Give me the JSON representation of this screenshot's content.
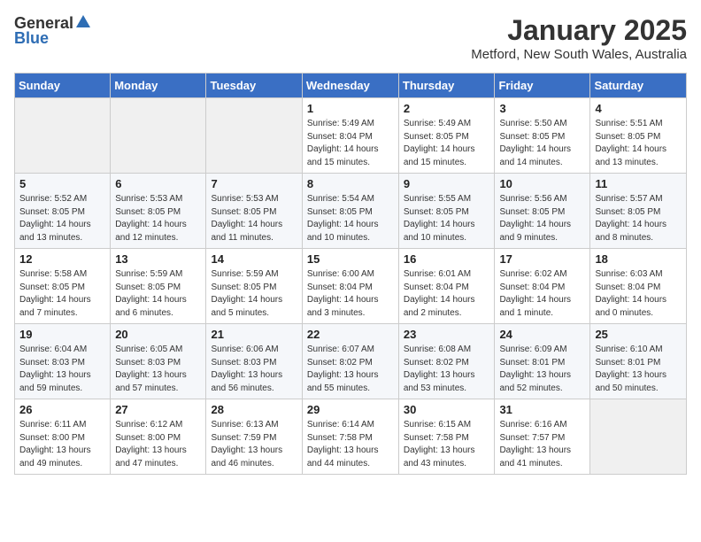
{
  "logo": {
    "general": "General",
    "blue": "Blue"
  },
  "header": {
    "month_year": "January 2025",
    "location": "Metford, New South Wales, Australia"
  },
  "weekdays": [
    "Sunday",
    "Monday",
    "Tuesday",
    "Wednesday",
    "Thursday",
    "Friday",
    "Saturday"
  ],
  "weeks": [
    [
      {
        "day": "",
        "sunrise": "",
        "sunset": "",
        "daylight": "",
        "empty": true
      },
      {
        "day": "",
        "sunrise": "",
        "sunset": "",
        "daylight": "",
        "empty": true
      },
      {
        "day": "",
        "sunrise": "",
        "sunset": "",
        "daylight": "",
        "empty": true
      },
      {
        "day": "1",
        "sunrise": "Sunrise: 5:49 AM",
        "sunset": "Sunset: 8:04 PM",
        "daylight": "Daylight: 14 hours and 15 minutes."
      },
      {
        "day": "2",
        "sunrise": "Sunrise: 5:49 AM",
        "sunset": "Sunset: 8:05 PM",
        "daylight": "Daylight: 14 hours and 15 minutes."
      },
      {
        "day": "3",
        "sunrise": "Sunrise: 5:50 AM",
        "sunset": "Sunset: 8:05 PM",
        "daylight": "Daylight: 14 hours and 14 minutes."
      },
      {
        "day": "4",
        "sunrise": "Sunrise: 5:51 AM",
        "sunset": "Sunset: 8:05 PM",
        "daylight": "Daylight: 14 hours and 13 minutes."
      }
    ],
    [
      {
        "day": "5",
        "sunrise": "Sunrise: 5:52 AM",
        "sunset": "Sunset: 8:05 PM",
        "daylight": "Daylight: 14 hours and 13 minutes."
      },
      {
        "day": "6",
        "sunrise": "Sunrise: 5:53 AM",
        "sunset": "Sunset: 8:05 PM",
        "daylight": "Daylight: 14 hours and 12 minutes."
      },
      {
        "day": "7",
        "sunrise": "Sunrise: 5:53 AM",
        "sunset": "Sunset: 8:05 PM",
        "daylight": "Daylight: 14 hours and 11 minutes."
      },
      {
        "day": "8",
        "sunrise": "Sunrise: 5:54 AM",
        "sunset": "Sunset: 8:05 PM",
        "daylight": "Daylight: 14 hours and 10 minutes."
      },
      {
        "day": "9",
        "sunrise": "Sunrise: 5:55 AM",
        "sunset": "Sunset: 8:05 PM",
        "daylight": "Daylight: 14 hours and 10 minutes."
      },
      {
        "day": "10",
        "sunrise": "Sunrise: 5:56 AM",
        "sunset": "Sunset: 8:05 PM",
        "daylight": "Daylight: 14 hours and 9 minutes."
      },
      {
        "day": "11",
        "sunrise": "Sunrise: 5:57 AM",
        "sunset": "Sunset: 8:05 PM",
        "daylight": "Daylight: 14 hours and 8 minutes."
      }
    ],
    [
      {
        "day": "12",
        "sunrise": "Sunrise: 5:58 AM",
        "sunset": "Sunset: 8:05 PM",
        "daylight": "Daylight: 14 hours and 7 minutes."
      },
      {
        "day": "13",
        "sunrise": "Sunrise: 5:59 AM",
        "sunset": "Sunset: 8:05 PM",
        "daylight": "Daylight: 14 hours and 6 minutes."
      },
      {
        "day": "14",
        "sunrise": "Sunrise: 5:59 AM",
        "sunset": "Sunset: 8:05 PM",
        "daylight": "Daylight: 14 hours and 5 minutes."
      },
      {
        "day": "15",
        "sunrise": "Sunrise: 6:00 AM",
        "sunset": "Sunset: 8:04 PM",
        "daylight": "Daylight: 14 hours and 3 minutes."
      },
      {
        "day": "16",
        "sunrise": "Sunrise: 6:01 AM",
        "sunset": "Sunset: 8:04 PM",
        "daylight": "Daylight: 14 hours and 2 minutes."
      },
      {
        "day": "17",
        "sunrise": "Sunrise: 6:02 AM",
        "sunset": "Sunset: 8:04 PM",
        "daylight": "Daylight: 14 hours and 1 minute."
      },
      {
        "day": "18",
        "sunrise": "Sunrise: 6:03 AM",
        "sunset": "Sunset: 8:04 PM",
        "daylight": "Daylight: 14 hours and 0 minutes."
      }
    ],
    [
      {
        "day": "19",
        "sunrise": "Sunrise: 6:04 AM",
        "sunset": "Sunset: 8:03 PM",
        "daylight": "Daylight: 13 hours and 59 minutes."
      },
      {
        "day": "20",
        "sunrise": "Sunrise: 6:05 AM",
        "sunset": "Sunset: 8:03 PM",
        "daylight": "Daylight: 13 hours and 57 minutes."
      },
      {
        "day": "21",
        "sunrise": "Sunrise: 6:06 AM",
        "sunset": "Sunset: 8:03 PM",
        "daylight": "Daylight: 13 hours and 56 minutes."
      },
      {
        "day": "22",
        "sunrise": "Sunrise: 6:07 AM",
        "sunset": "Sunset: 8:02 PM",
        "daylight": "Daylight: 13 hours and 55 minutes."
      },
      {
        "day": "23",
        "sunrise": "Sunrise: 6:08 AM",
        "sunset": "Sunset: 8:02 PM",
        "daylight": "Daylight: 13 hours and 53 minutes."
      },
      {
        "day": "24",
        "sunrise": "Sunrise: 6:09 AM",
        "sunset": "Sunset: 8:01 PM",
        "daylight": "Daylight: 13 hours and 52 minutes."
      },
      {
        "day": "25",
        "sunrise": "Sunrise: 6:10 AM",
        "sunset": "Sunset: 8:01 PM",
        "daylight": "Daylight: 13 hours and 50 minutes."
      }
    ],
    [
      {
        "day": "26",
        "sunrise": "Sunrise: 6:11 AM",
        "sunset": "Sunset: 8:00 PM",
        "daylight": "Daylight: 13 hours and 49 minutes."
      },
      {
        "day": "27",
        "sunrise": "Sunrise: 6:12 AM",
        "sunset": "Sunset: 8:00 PM",
        "daylight": "Daylight: 13 hours and 47 minutes."
      },
      {
        "day": "28",
        "sunrise": "Sunrise: 6:13 AM",
        "sunset": "Sunset: 7:59 PM",
        "daylight": "Daylight: 13 hours and 46 minutes."
      },
      {
        "day": "29",
        "sunrise": "Sunrise: 6:14 AM",
        "sunset": "Sunset: 7:58 PM",
        "daylight": "Daylight: 13 hours and 44 minutes."
      },
      {
        "day": "30",
        "sunrise": "Sunrise: 6:15 AM",
        "sunset": "Sunset: 7:58 PM",
        "daylight": "Daylight: 13 hours and 43 minutes."
      },
      {
        "day": "31",
        "sunrise": "Sunrise: 6:16 AM",
        "sunset": "Sunset: 7:57 PM",
        "daylight": "Daylight: 13 hours and 41 minutes."
      },
      {
        "day": "",
        "sunrise": "",
        "sunset": "",
        "daylight": "",
        "empty": true
      }
    ]
  ]
}
